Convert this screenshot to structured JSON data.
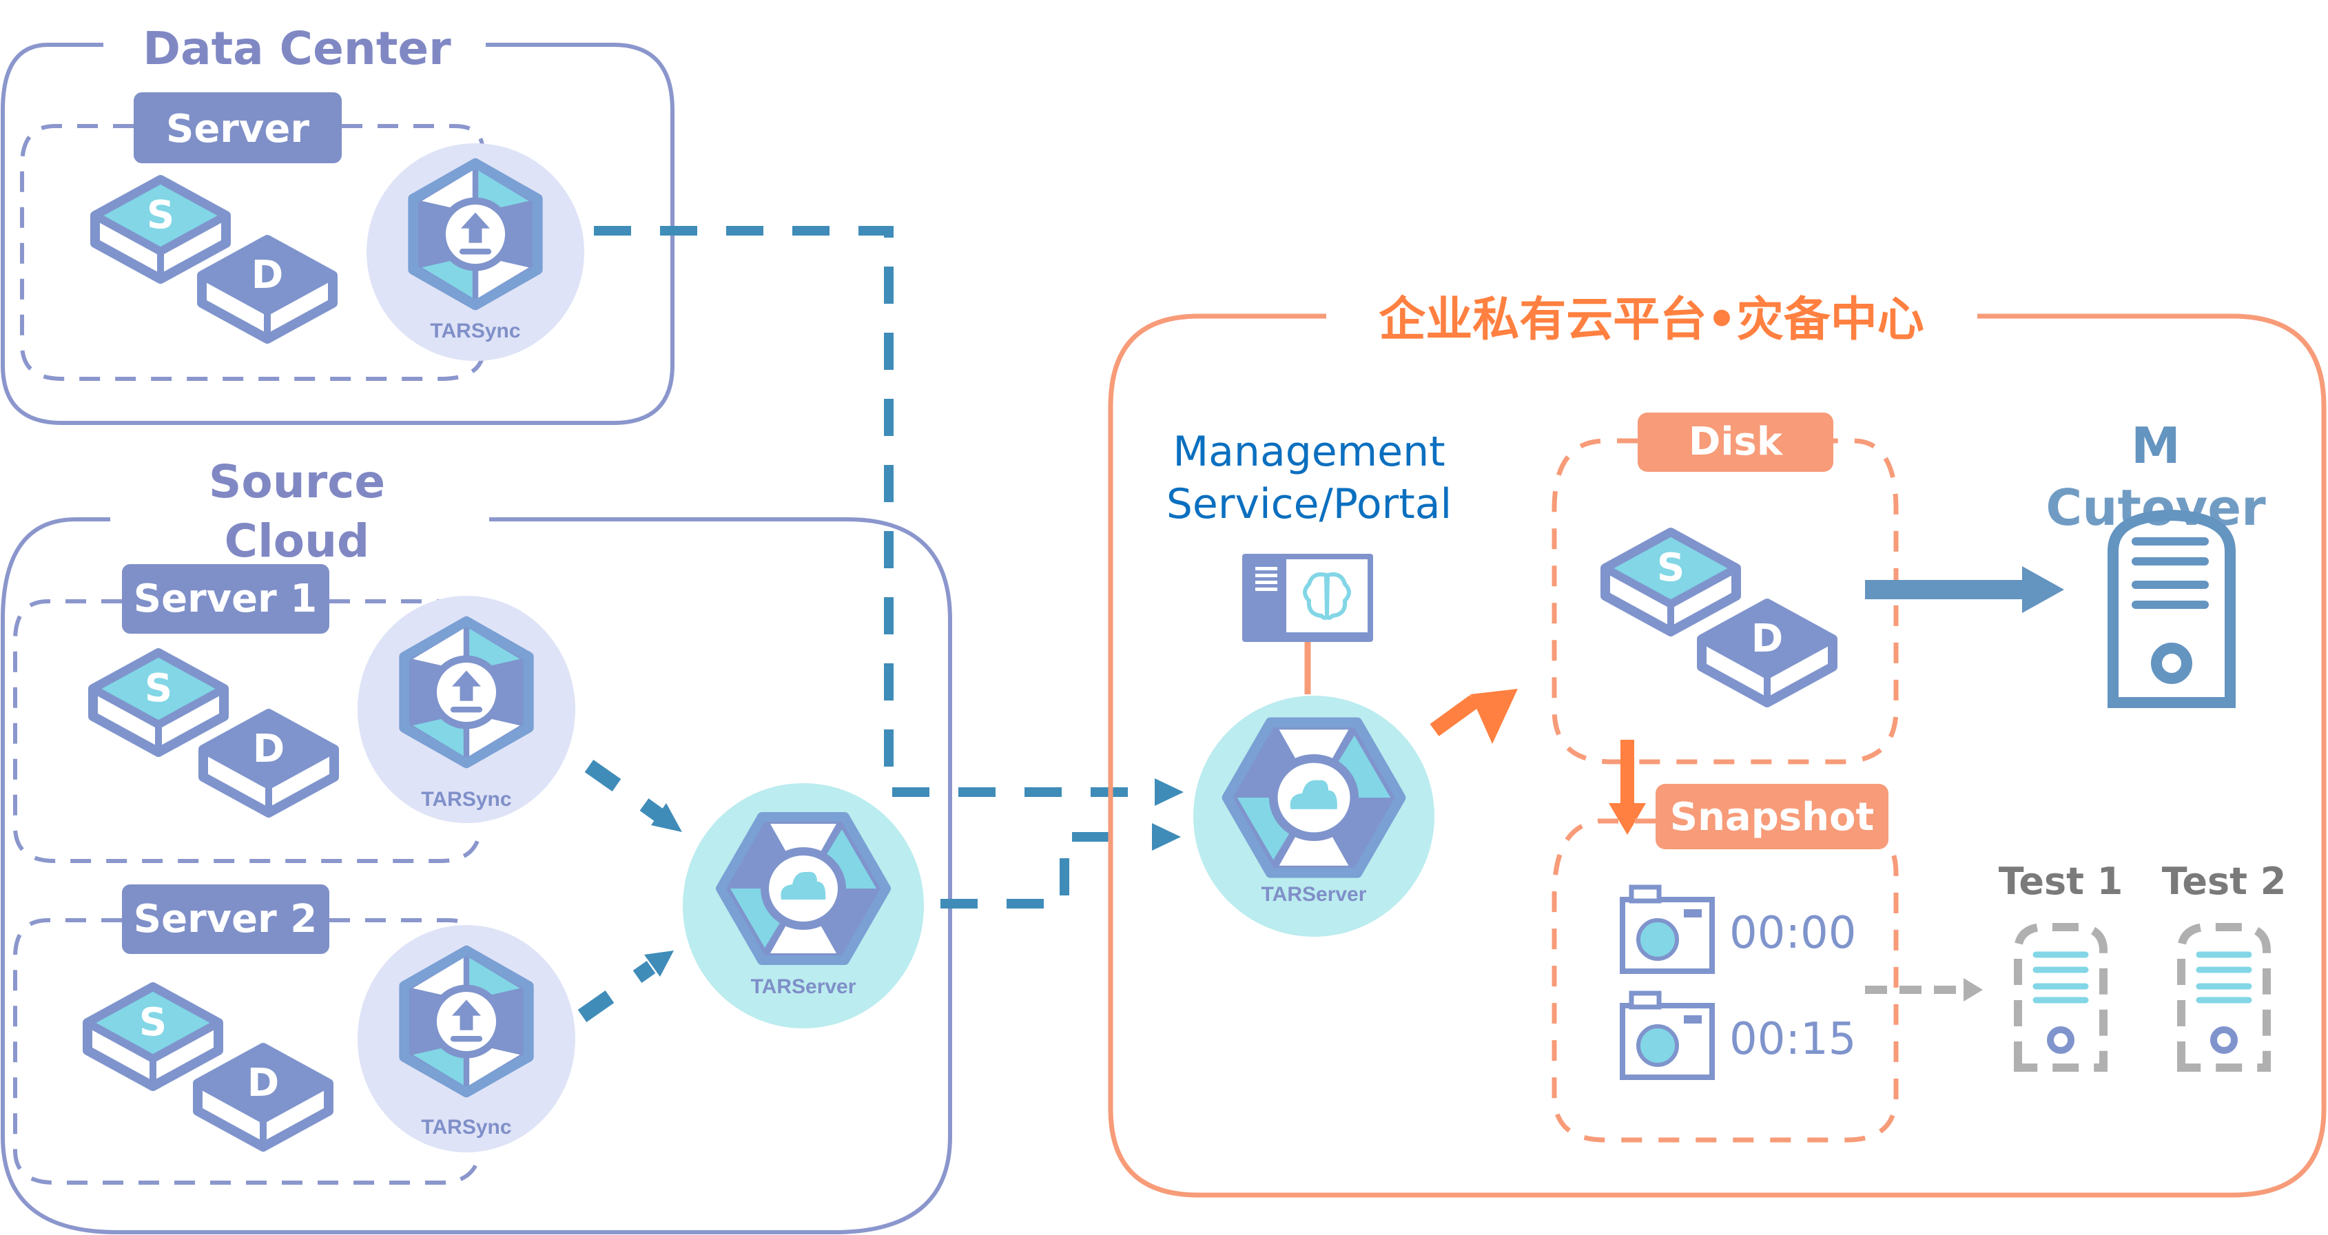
{
  "colors": {
    "region_stroke": "#8a96cc",
    "label_fill": "#7f8fc8",
    "accent_blue": "#3f8cb8",
    "orange": "#ff8040",
    "orange_light": "#f79b78",
    "cyan": "#82d6e6",
    "tarsync_bg": "#dfe3f7",
    "tarserver_bg": "#bbecef",
    "mgmt_text": "#0b6fbf",
    "cutover": "#6494c0",
    "gray": "#b0b0b0"
  },
  "data_center": {
    "title": "Data Center",
    "server_label": "Server",
    "disk_s": "S",
    "disk_d": "D",
    "agent_label": "TARSync"
  },
  "source_cloud": {
    "title_line1": "Source",
    "title_line2": "Cloud",
    "servers": [
      {
        "label": "Server 1",
        "disk_s": "S",
        "disk_d": "D",
        "agent_label": "TARSync"
      },
      {
        "label": "Server 2",
        "disk_s": "S",
        "disk_d": "D",
        "agent_label": "TARSync"
      }
    ],
    "relay_label": "TARServer"
  },
  "dr_center": {
    "title": "企业私有云平台•灾备中心",
    "management_line1": "Management",
    "management_line2": "Service/Portal",
    "server_label": "TARServer",
    "disk_label": "Disk",
    "disk_s": "S",
    "disk_d": "D",
    "snapshot_label": "Snapshot",
    "snapshots": [
      "00:00",
      "00:15"
    ],
    "cutover_line1": "M",
    "cutover_line2": "Cutover",
    "tests": [
      "Test 1",
      "Test 2"
    ]
  }
}
